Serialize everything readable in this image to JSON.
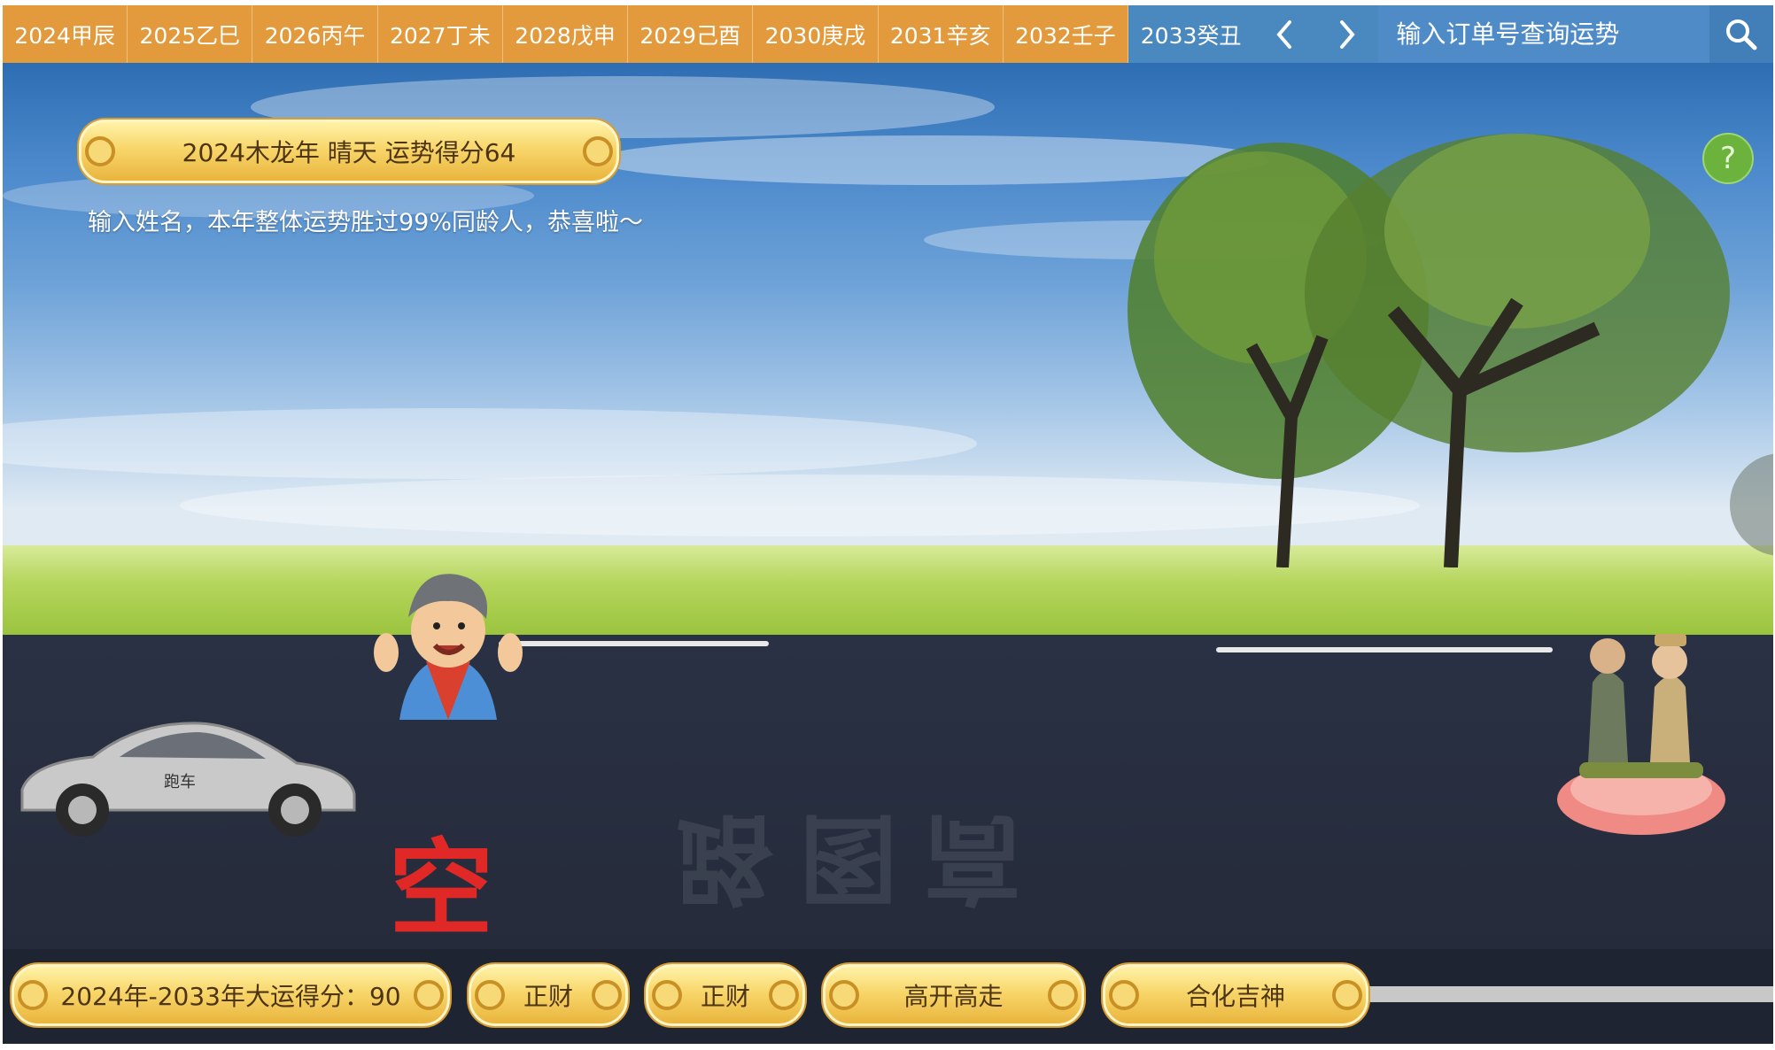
{
  "nav": {
    "years": [
      "2024甲辰",
      "2025乙巳",
      "2026丙午",
      "2027丁未",
      "2028戊申",
      "2029己酉",
      "2030庚戌",
      "2031辛亥",
      "2032壬子",
      "2033癸丑"
    ],
    "active_year": "2033癸丑",
    "prev_icon": "chevron-left-icon",
    "next_icon": "chevron-right-icon",
    "search_placeholder": "输入订单号查询运势",
    "search_icon": "search-icon"
  },
  "fortune": {
    "title": "2024木龙年 晴天 运势得分64",
    "description": "输入姓名，本年整体运势胜过99%同龄人，恭喜啦～"
  },
  "help": {
    "label": "?"
  },
  "road": {
    "sign_text": "路图高",
    "car_label": "跑车",
    "kong_label": "空"
  },
  "bottom": {
    "score_label": "2024年-2033年大运得分：90",
    "tags": [
      "正财",
      "正财",
      "高开高走",
      "合化吉神"
    ]
  },
  "colors": {
    "tab_orange": "#e39a3c",
    "tab_active_blue": "#4a88c0",
    "road_dark": "#252b3a",
    "scroll_gold": "#f8d66a",
    "kong_red": "#e02826",
    "help_green": "#6cb33d"
  }
}
